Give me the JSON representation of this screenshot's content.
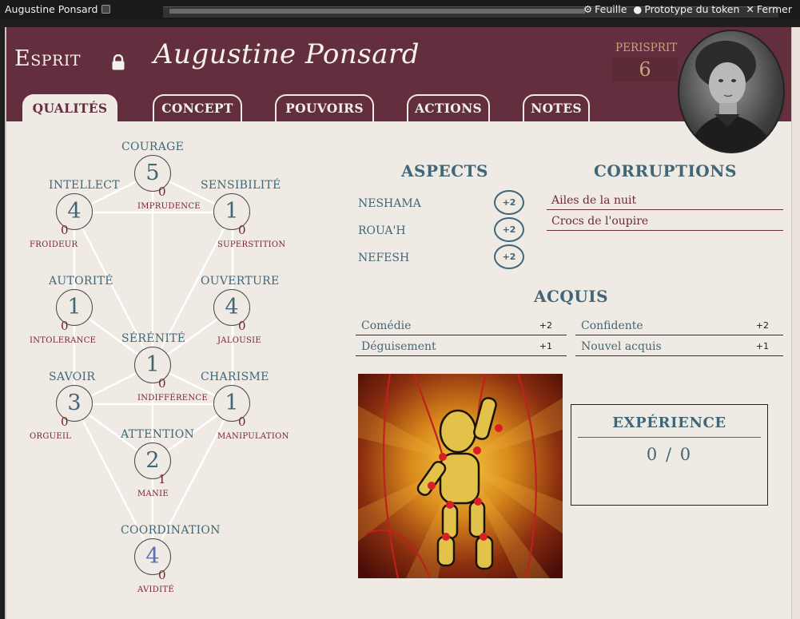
{
  "window": {
    "title": "Augustine Ponsard",
    "actions": [
      {
        "label": "Feuille",
        "icon": "gear-icon"
      },
      {
        "label": "Prototype du token",
        "icon": "user-circle-icon"
      },
      {
        "label": "Fermer",
        "icon": "close-icon"
      }
    ]
  },
  "header": {
    "kind": "Esprit",
    "name": "Augustine Ponsard",
    "perisprit_label": "PERISPRIT",
    "perisprit_value": "6",
    "tabs": [
      "QUALITÉS",
      "CONCEPT",
      "POUVOIRS",
      "ACTIONS",
      "NOTES"
    ],
    "active_tab": "QUALITÉS"
  },
  "qualities": {
    "courage": {
      "label": "COURAGE",
      "value": "5",
      "flaw_value": "0",
      "flaw": "IMPRUDENCE"
    },
    "intellect": {
      "label": "INTELLECT",
      "value": "4",
      "flaw_value": "0",
      "flaw": "FROIDEUR"
    },
    "sensibilite": {
      "label": "SENSIBILITÉ",
      "value": "1",
      "flaw_value": "0",
      "flaw": "SUPERSTITION"
    },
    "autorite": {
      "label": "AUTORITÉ",
      "value": "1",
      "flaw_value": "0",
      "flaw": "INTOLERANCE"
    },
    "ouverture": {
      "label": "OUVERTURE",
      "value": "4",
      "flaw_value": "0",
      "flaw": "JALOUSIE"
    },
    "serenite": {
      "label": "SÉRÉNITÉ",
      "value": "1",
      "flaw_value": "0",
      "flaw": "INDIFFÉRENCE"
    },
    "savoir": {
      "label": "SAVOIR",
      "value": "3",
      "flaw_value": "0",
      "flaw": "ORGUEIL"
    },
    "charisme": {
      "label": "CHARISME",
      "value": "1",
      "flaw_value": "0",
      "flaw": "MANIPULATION"
    },
    "attention": {
      "label": "ATTENTION",
      "value": "2",
      "flaw_value": "1",
      "flaw": "MANIE"
    },
    "coordination": {
      "label": "COORDINATION",
      "value": "4",
      "flaw_value": "0",
      "flaw": "AVIDITÉ"
    }
  },
  "aspects": {
    "title": "ASPECTS",
    "items": [
      {
        "name": "NESHAMA",
        "bonus": "+2"
      },
      {
        "name": "ROUA'H",
        "bonus": "+2"
      },
      {
        "name": "NEFESH",
        "bonus": "+2"
      }
    ]
  },
  "corruptions": {
    "title": "CORRUPTIONS",
    "items": [
      "Ailes de la nuit",
      "Crocs de l'oupire"
    ]
  },
  "acquis": {
    "title": "ACQUIS",
    "items": [
      {
        "name": "Comédie",
        "value": "+2"
      },
      {
        "name": "Confidente",
        "value": "+2"
      },
      {
        "name": "Déguisement",
        "value": "+1"
      },
      {
        "name": "Nouvel acquis",
        "value": "+1"
      }
    ]
  },
  "experience": {
    "title": "EXPÉRIENCE",
    "current": "0",
    "separator": "/",
    "total": "0"
  },
  "colors": {
    "header_bg": "#632f3e",
    "accent_blue": "#3f6778",
    "flaw_red": "#7a1f2c",
    "paper": "#efeae3"
  }
}
